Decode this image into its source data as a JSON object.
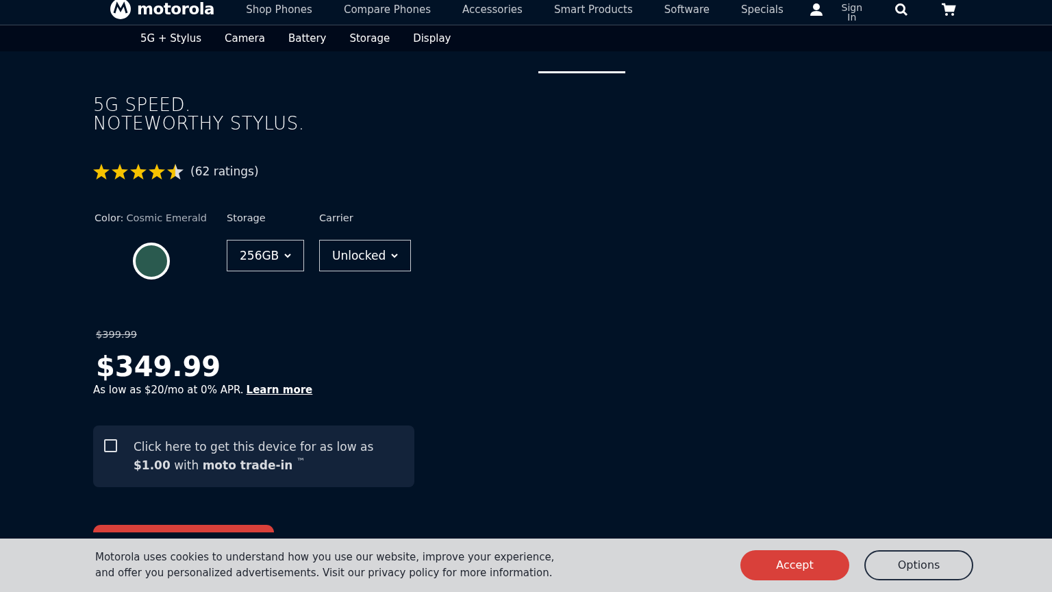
{
  "brand": {
    "name": "motorola"
  },
  "nav": [
    {
      "label": "Shop Phones"
    },
    {
      "label": "Compare Phones"
    },
    {
      "label": "Accessories"
    },
    {
      "label": "Smart Products"
    },
    {
      "label": "Software"
    },
    {
      "label": "Specials"
    }
  ],
  "account": {
    "label": "Sign In"
  },
  "subnav": [
    {
      "label": "5G + Stylus"
    },
    {
      "label": "Camera"
    },
    {
      "label": "Battery"
    },
    {
      "label": "Storage"
    },
    {
      "label": "Display"
    }
  ],
  "carousel": [
    {
      "selected": true
    }
  ],
  "product": {
    "title_lines": [
      "5G SPEED.",
      "NOTEWORTHY STYLUS."
    ],
    "stars": 4.5,
    "ratings": "(62 ratings)",
    "color_label": "Color:",
    "color_name": "Cosmic Emerald",
    "swatches": [
      {
        "color": "#2a5a4f",
        "selected": true
      }
    ],
    "storage_label": "Storage",
    "storage_value": "256GB",
    "carrier_label": "Carrier",
    "carrier_value": "Unlocked",
    "old_price": "$399.99",
    "price": "$349.99",
    "financing": "As low as $20/mo at 0% APR.",
    "learn_more": "Learn more",
    "trade_in": {
      "checked": false,
      "text": "Click here to get this device for as low as **$1.00** with **moto trade-in** $^{™}$"
    }
  },
  "cookie_banner": {
    "text": "Motorola uses cookies to understand how you use our website, improve your experience, and offer you personalized advertisements. Visit our privacy policy for more information.",
    "accept": "Accept",
    "options": "Options"
  }
}
